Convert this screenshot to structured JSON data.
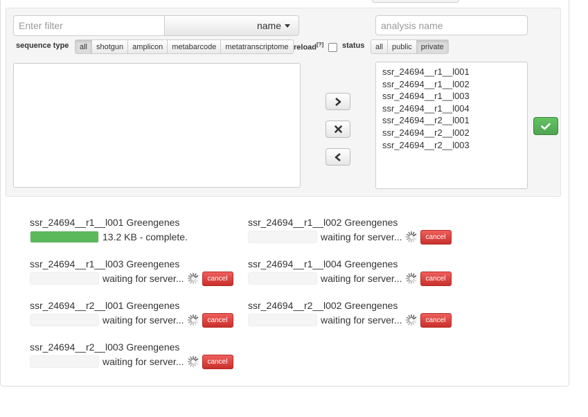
{
  "filter": {
    "placeholder": "Enter filter",
    "value": ""
  },
  "sort": {
    "selected": "name"
  },
  "analysis": {
    "placeholder": "analysis name",
    "value": ""
  },
  "sequence_type": {
    "label": "sequence type",
    "options": [
      "all",
      "shotgun",
      "amplicon",
      "metabarcode",
      "metatranscriptome"
    ],
    "selected": "all"
  },
  "reload": {
    "label": "reload",
    "help": "[?]",
    "checked": false
  },
  "status": {
    "label": "status",
    "options": [
      "all",
      "public",
      "private"
    ],
    "selected": "private"
  },
  "available_list": [],
  "selected_list": [
    "ssr_24694__r1__l001",
    "ssr_24694__r1__l002",
    "ssr_24694__r1__l003",
    "ssr_24694__r1__l004",
    "ssr_24694__r2__l001",
    "ssr_24694__r2__l002",
    "ssr_24694__r2__l003"
  ],
  "buttons": {
    "add_icon": "chevron-right-icon",
    "clear_icon": "remove-icon",
    "remove_icon": "chevron-left-icon",
    "confirm_icon": "check-icon"
  },
  "jobs": [
    {
      "title": "ssr_24694__r1__l001 Greengenes",
      "status": "13.2 KB - complete.",
      "progress": 1.0,
      "complete": true
    },
    {
      "title": "ssr_24694__r1__l002 Greengenes",
      "status": "waiting for server...",
      "progress": 0,
      "complete": false,
      "cancel_label": "cancel"
    },
    {
      "title": "ssr_24694__r1__l003 Greengenes",
      "status": "waiting for server...",
      "progress": 0,
      "complete": false,
      "cancel_label": "cancel"
    },
    {
      "title": "ssr_24694__r1__l004 Greengenes",
      "status": "waiting for server...",
      "progress": 0,
      "complete": false,
      "cancel_label": "cancel"
    },
    {
      "title": "ssr_24694__r2__l001 Greengenes",
      "status": "waiting for server...",
      "progress": 0,
      "complete": false,
      "cancel_label": "cancel"
    },
    {
      "title": "ssr_24694__r2__l002 Greengenes",
      "status": "waiting for server...",
      "progress": 0,
      "complete": false,
      "cancel_label": "cancel"
    },
    {
      "title": "ssr_24694__r2__l003 Greengenes",
      "status": "waiting for server...",
      "progress": 0,
      "complete": false,
      "cancel_label": "cancel"
    }
  ],
  "colors": {
    "success": "#5cb85c",
    "danger": "#d9534f",
    "well": "#f5f5f5"
  }
}
